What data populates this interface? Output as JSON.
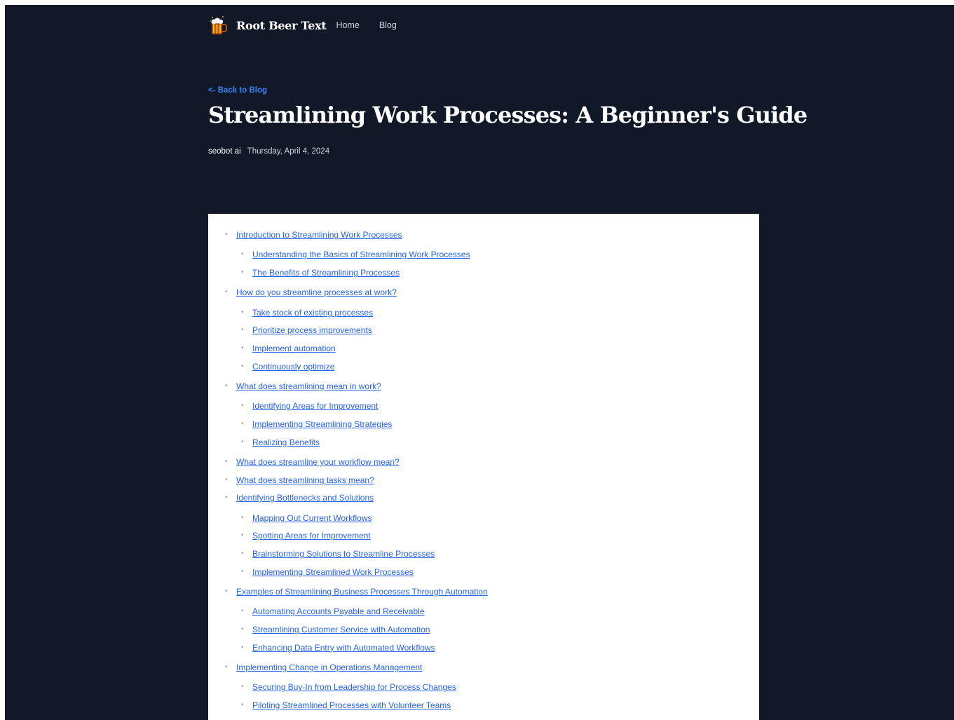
{
  "header": {
    "brand": "Root Beer Text",
    "nav": [
      "Home",
      "Blog"
    ]
  },
  "post": {
    "back_link": "<- Back to Blog",
    "title": "Streamlining Work Processes: A Beginner's Guide",
    "author": "seobot ai",
    "date": "Thursday, April 4, 2024"
  },
  "toc": [
    {
      "label": "Introduction to Streamlining Work Processes",
      "level": 1
    },
    {
      "label": "Understanding the Basics of Streamlining Work Processes",
      "level": 2
    },
    {
      "label": "The Benefits of Streamlining Processes",
      "level": 2
    },
    {
      "label": "How do you streamline processes at work?",
      "level": 1
    },
    {
      "label": "Take stock of existing processes",
      "level": 2
    },
    {
      "label": "Prioritize process improvements",
      "level": 2
    },
    {
      "label": "Implement automation",
      "level": 2
    },
    {
      "label": "Continuously optimize",
      "level": 2
    },
    {
      "label": "What does streamlining mean in work?",
      "level": 1
    },
    {
      "label": "Identifying Areas for Improvement",
      "level": 2
    },
    {
      "label": "Implementing Streamlining Strategies",
      "level": 2
    },
    {
      "label": "Realizing Benefits",
      "level": 2
    },
    {
      "label": "What does streamline your workflow mean?",
      "level": 1
    },
    {
      "label": "What does streamlining tasks mean?",
      "level": 1
    },
    {
      "label": "Identifying Bottlenecks and Solutions",
      "level": 1
    },
    {
      "label": "Mapping Out Current Workflows",
      "level": 2
    },
    {
      "label": "Spotting Areas for Improvement",
      "level": 2
    },
    {
      "label": "Brainstorming Solutions to Streamline Processes",
      "level": 2
    },
    {
      "label": "Implementing Streamlined Work Processes",
      "level": 2
    },
    {
      "label": "Examples of Streamlining Business Processes Through Automation",
      "level": 1
    },
    {
      "label": "Automating Accounts Payable and Receivable",
      "level": 2
    },
    {
      "label": "Streamlining Customer Service with Automation",
      "level": 2
    },
    {
      "label": "Enhancing Data Entry with Automated Workflows",
      "level": 2
    },
    {
      "label": "Implementing Change in Operations Management",
      "level": 1
    },
    {
      "label": "Securing Buy-In from Leadership for Process Changes",
      "level": 2
    },
    {
      "label": "Piloting Streamlined Processes with Volunteer Teams",
      "level": 2
    }
  ],
  "icons": {
    "logo": "root-beer-mug-icon"
  },
  "colors": {
    "background": "#111827",
    "link": "#2563eb",
    "back_link": "#3b82f6"
  }
}
